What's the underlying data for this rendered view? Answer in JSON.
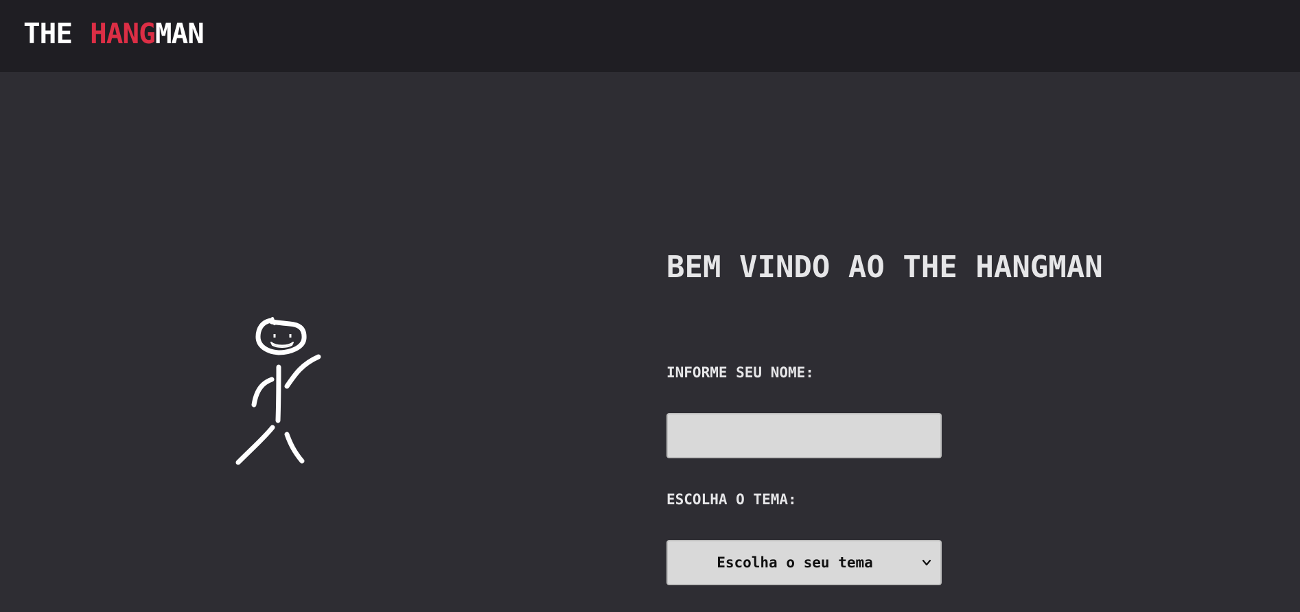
{
  "header": {
    "logo_word1": "THE",
    "logo_accent": "HANG",
    "logo_rest": "MAN"
  },
  "main": {
    "title": "BEM VINDO AO THE HANGMAN",
    "name_label": "INFORME SEU NOME:",
    "name_value": "",
    "theme_label": "ESCOLHA O TEMA:",
    "theme_selected": "Escolha o seu tema"
  },
  "icons": {
    "illustration": "stick-figure-icon",
    "select_arrow": "chevron-down-icon"
  },
  "colors": {
    "header_bg": "#1f1e23",
    "page_bg": "#2e2d33",
    "accent": "#dc2e45",
    "text": "#e6e6e8",
    "field_bg": "#d9d9d9"
  }
}
